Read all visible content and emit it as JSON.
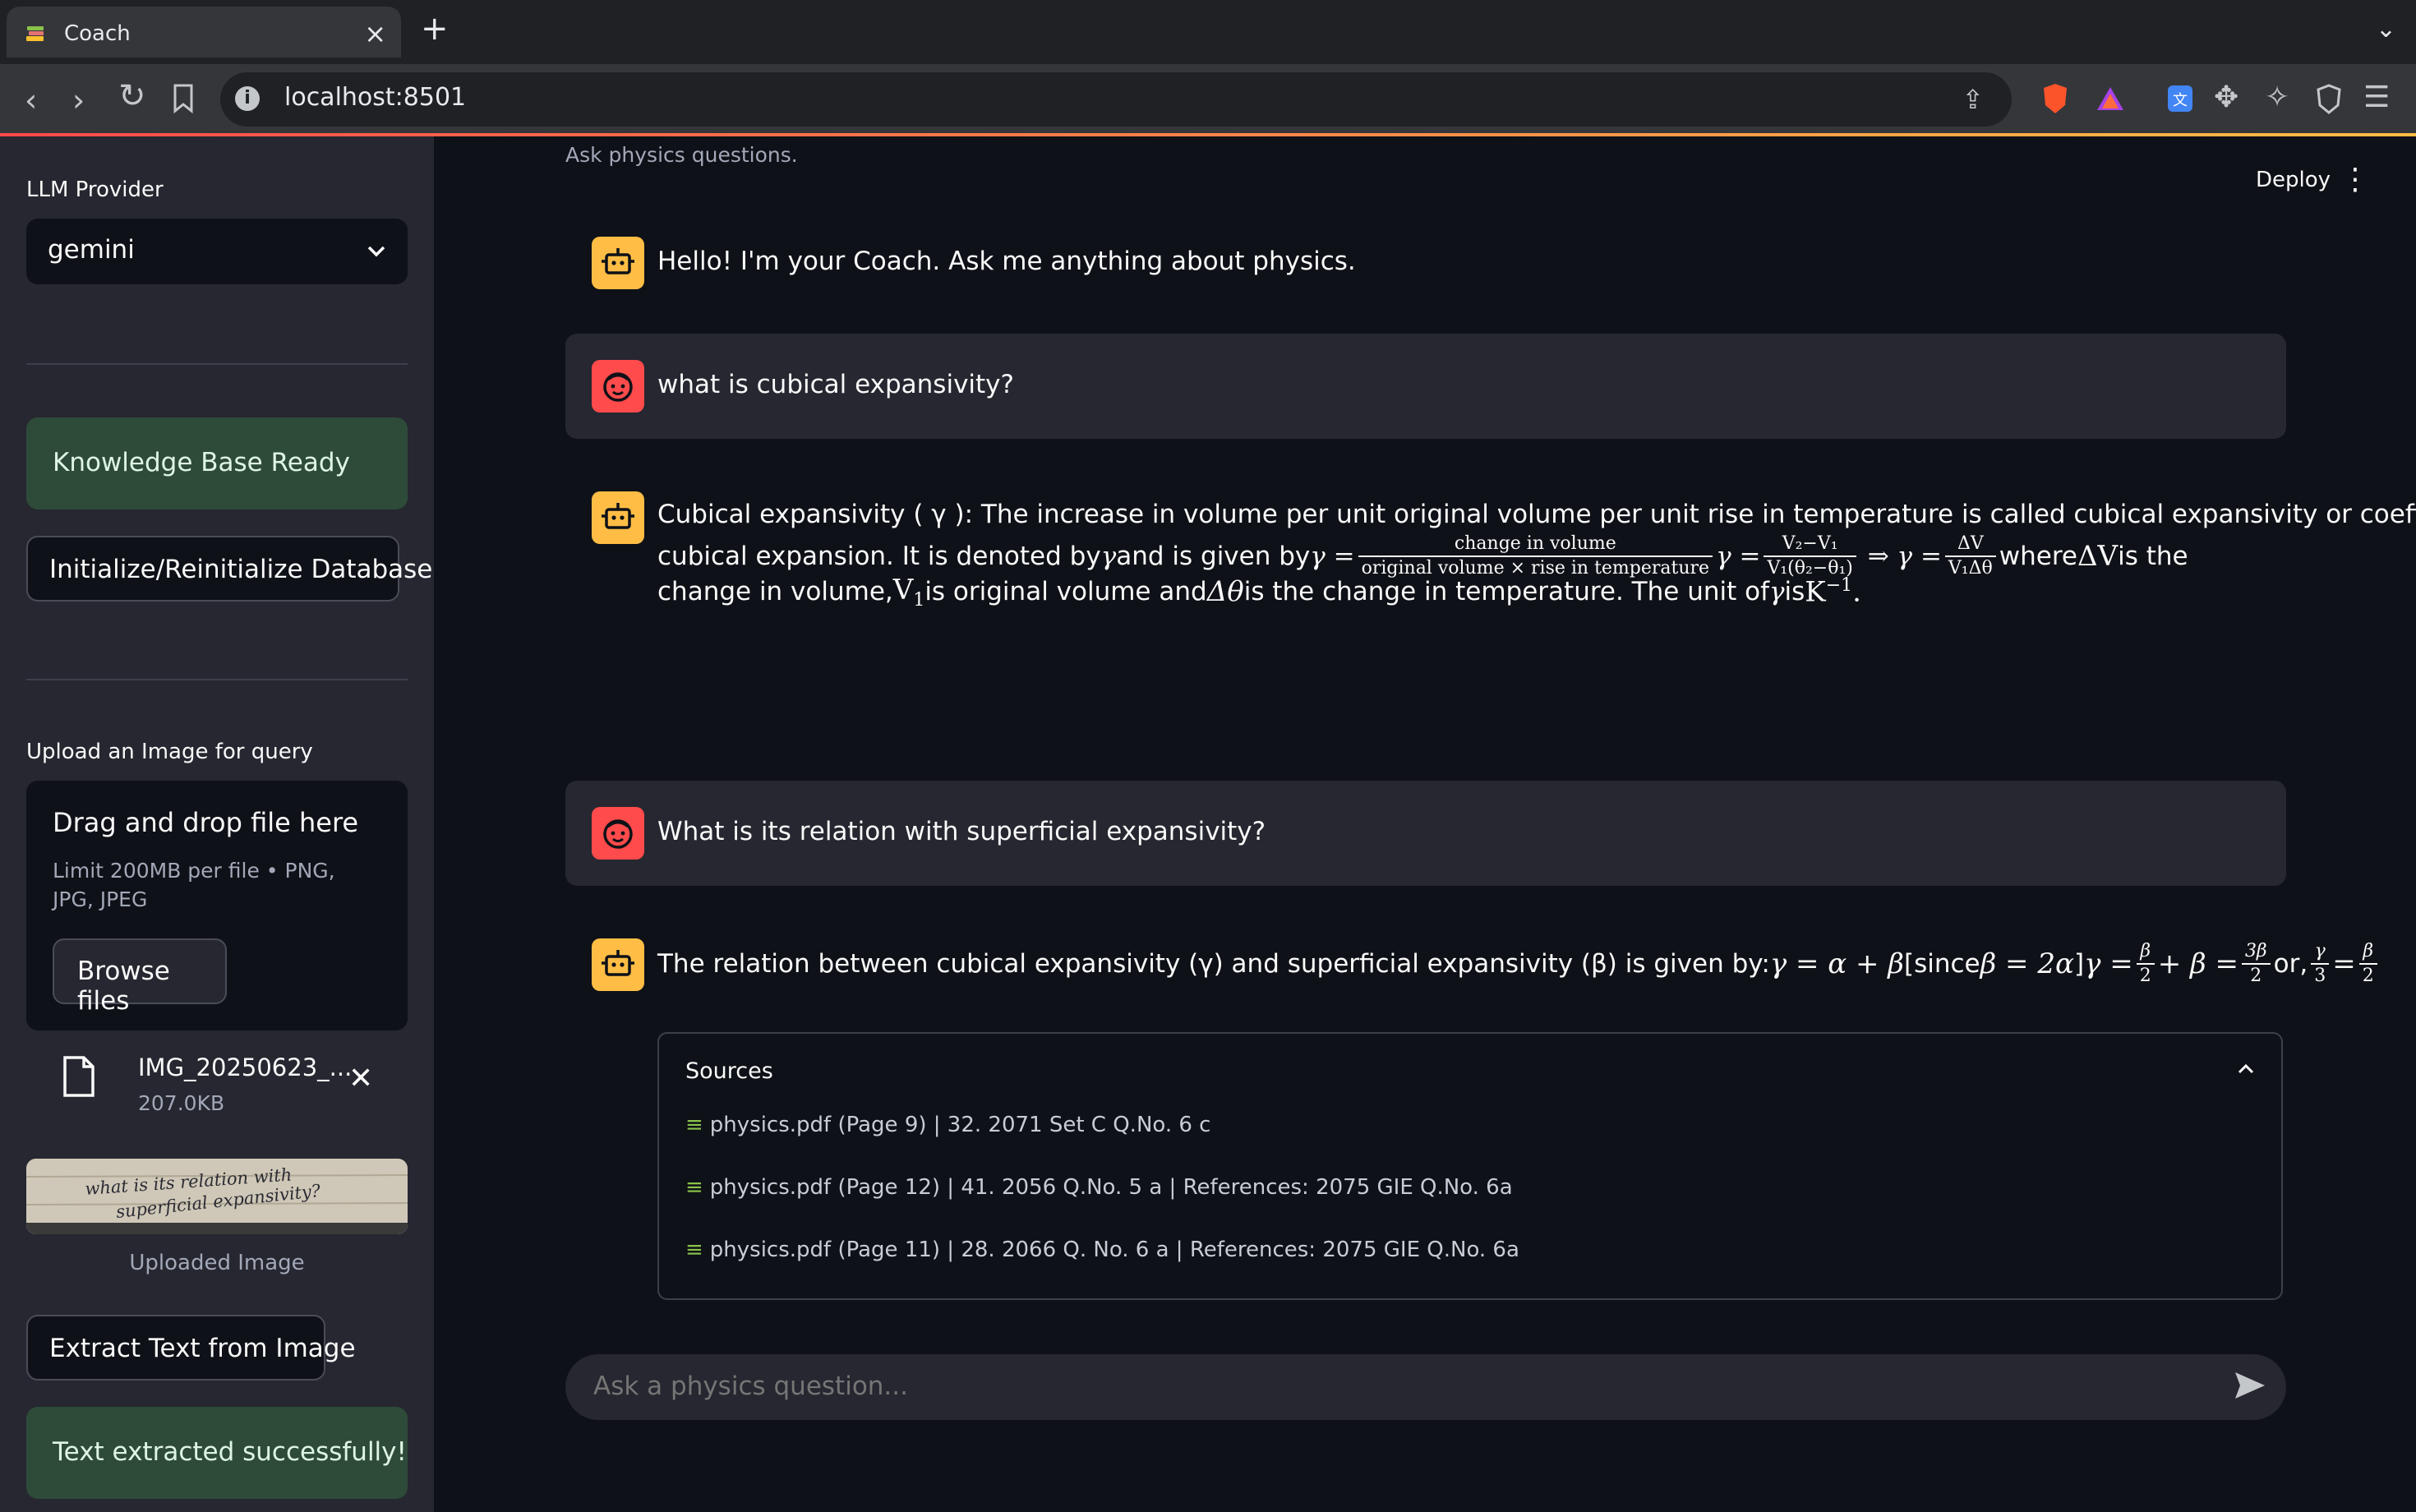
{
  "browser": {
    "tab_title": "Coach",
    "url": "localhost:8501",
    "icons": [
      "back-icon",
      "forward-icon",
      "reload-icon",
      "bookmark-icon",
      "share-icon",
      "brave-shield-icon",
      "brave-rewards-icon",
      "extension-icon",
      "puzzle-icon",
      "ai-sparkle-icon",
      "vpn-shield-icon",
      "menu-icon"
    ]
  },
  "sidebar": {
    "llm_label": "LLM Provider",
    "llm_value": "gemini",
    "kb_status": "Knowledge Base Ready",
    "init_button": "Initialize/Reinitialize Database",
    "upload_label": "Upload an Image for query",
    "dropzone_title": "Drag and drop file here",
    "dropzone_limit": "Limit 200MB per file • PNG, JPG, JPEG",
    "browse_button": "Browse files",
    "file_name": "IMG_20250623_...",
    "file_size": "207.0KB",
    "thumbnail_handwriting": [
      "what is its relation with",
      "superficial expansivity?"
    ],
    "uploaded_caption": "Uploaded Image",
    "extract_button": "Extract Text from Image",
    "extract_status": "Text extracted successfully!"
  },
  "main": {
    "caption": "Ask physics questions.",
    "deploy": "Deploy",
    "messages": {
      "greeting": "Hello! I'm your Coach. Ask me anything about physics.",
      "q1": "what is cubical expansivity?",
      "a1": {
        "line1": "Cubical expansivity ( γ ): The increase in volume per unit original volume per unit rise in temperature is called cubical expansivity or coefficient of",
        "line2_pre": "cubical expansion. It is denoted by ",
        "line2_mid": " and is given by ",
        "frac1_num": "change in volume",
        "frac1_den": "original volume × rise in temperature",
        "frac2_num": "V₂−V₁",
        "frac2_den": "V₁(θ₂−θ₁)",
        "frac3_num": "ΔV",
        "frac3_den": "V₁Δθ",
        "line2_where": " where ",
        "line2_is_the": " is the",
        "line3_a": "change in volume, ",
        "line3_b": " is original volume and ",
        "line3_c": " is the change in temperature. The unit of ",
        "line3_d": " is "
      },
      "q2": "What is its relation with superficial expansivity?",
      "a2": {
        "pre": "The relation between cubical expansivity (γ) and superficial expansivity (β) is given by: ",
        "eq1": "γ = α + β",
        "since": " [since ",
        "eq2": "β = 2α",
        "close": "] ",
        "or": " or, "
      }
    },
    "sources_label": "Sources",
    "sources": [
      "physics.pdf (Page 9) | 32. 2071 Set C Q.No. 6 c",
      "physics.pdf (Page 12) | 41. 2056 Q.No. 5 a | References: 2075 GIE Q.No. 6a",
      "physics.pdf (Page 11) | 28. 2066 Q. No. 6 a | References: 2075 GIE Q.No. 6a"
    ],
    "chat_placeholder": "Ask a physics question..."
  },
  "colors": {
    "app_bg": "#0e1117",
    "sidebar_bg": "#262730",
    "success_bg": "#2e4b3a",
    "bot_avatar": "#ffbd45",
    "user_avatar": "#ff4b4b"
  }
}
